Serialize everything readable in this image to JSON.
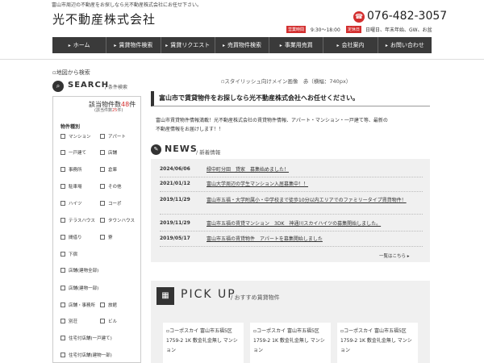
{
  "header": {
    "tagline": "富山市周辺の不動産をお探しなら光不動産株式会社にお任せ下さい。",
    "logo": "光不動産株式会社",
    "tel": "076-482-3057",
    "hours_badge": "営業時間",
    "hours": "9:30～18:00",
    "closed_badge": "定休日",
    "closed": "日曜日、年末年始、GW、お盆"
  },
  "nav": {
    "items": [
      {
        "label": "ホーム"
      },
      {
        "label": "賃貸物件検索"
      },
      {
        "label": "賃貸リクエスト"
      },
      {
        "label": "売買物件検索"
      },
      {
        "label": "事業用売買"
      },
      {
        "label": "会社案内"
      },
      {
        "label": "お問い合わせ"
      }
    ]
  },
  "sidebar": {
    "map_link": "地図から検索",
    "search_title": "SEARCH",
    "search_sub": "条件検索",
    "count_prefix": "該当物件数",
    "count_value": "48",
    "count_suffix": "件",
    "count_note_prefix": "(該当件数",
    "count_note_value": "25",
    "count_note_suffix": "件)",
    "type_label": "物件種別",
    "options": [
      {
        "label": "マンション"
      },
      {
        "label": "アパート"
      },
      {
        "label": "一戸建て"
      },
      {
        "label": "店舗"
      },
      {
        "label": "事務所"
      },
      {
        "label": "倉庫"
      },
      {
        "label": "駐車場"
      },
      {
        "label": "その他"
      },
      {
        "label": "ハイツ"
      },
      {
        "label": "コーポ"
      },
      {
        "label": "テラスハウス"
      },
      {
        "label": "タウンハウス"
      },
      {
        "label": "間借り"
      },
      {
        "label": "寮"
      },
      {
        "label": "下宿"
      },
      {
        "label": "店舗(建物全部)"
      },
      {
        "label": "店舗(建物一部)"
      },
      {
        "label": "店舗・事務所"
      },
      {
        "label": "旅館"
      },
      {
        "label": "別荘"
      },
      {
        "label": "ビル"
      },
      {
        "label": "住宅付店舗(一戸建て)"
      },
      {
        "label": "住宅付店舗(建物一部)"
      }
    ]
  },
  "main": {
    "banner_alt": "スタイリッシュ向けメイン画像　赤（横幅：740px）",
    "heading": "富山市で賃貸物件をお探しなら光不動産株式会社へお任せください。",
    "intro_lines": [
      "富山市賃貸物件情報満載！光不動産株式会社の賃貸物件情報、アパート・マンション・一戸建て等、最新の",
      "不動産情報をお届けします！！"
    ]
  },
  "news": {
    "title": "NEWS",
    "sub": "新着情報",
    "items": [
      {
        "date": "2024/06/06",
        "text": "緑中町分田　貸家　募集始めました！"
      },
      {
        "date": "2021/01/12",
        "text": "富山大学周辺の学生マンション入居募集中！！"
      },
      {
        "date": "2019/11/29",
        "text": "富山市五福・大学附属小・中学校まで徒歩10分以内エリアでのファミリータイプ賃貸物件！"
      },
      {
        "date": "2019/11/29",
        "text": "富山市五福の賃貸マンション　3DK　神通川スカイハイツの募集開始しました。"
      },
      {
        "date": "2019/05/17",
        "text": "富山市五福の賃貸物件　アパートを募集開始しました"
      }
    ],
    "more": "一覧はこちら"
  },
  "pickup": {
    "title": "PICK UP",
    "sub": "おすすめ賃貸物件",
    "cards": [
      {
        "text": "コーポスカイ 富山市五福5区1759-2 1K 敷金礼金無し マンション"
      },
      {
        "text": "コーポスカイ 富山市五福5区1759-2 1K 敷金礼金無し マンション"
      },
      {
        "text": "コーポスカイ 富山市五福5区1759-2 1K 敷金礼金無し マンション"
      }
    ]
  },
  "colors": {
    "accent": "#d32f2f",
    "nav_bg": "#3a3a3a",
    "panel_bg": "#f0f0f0"
  }
}
